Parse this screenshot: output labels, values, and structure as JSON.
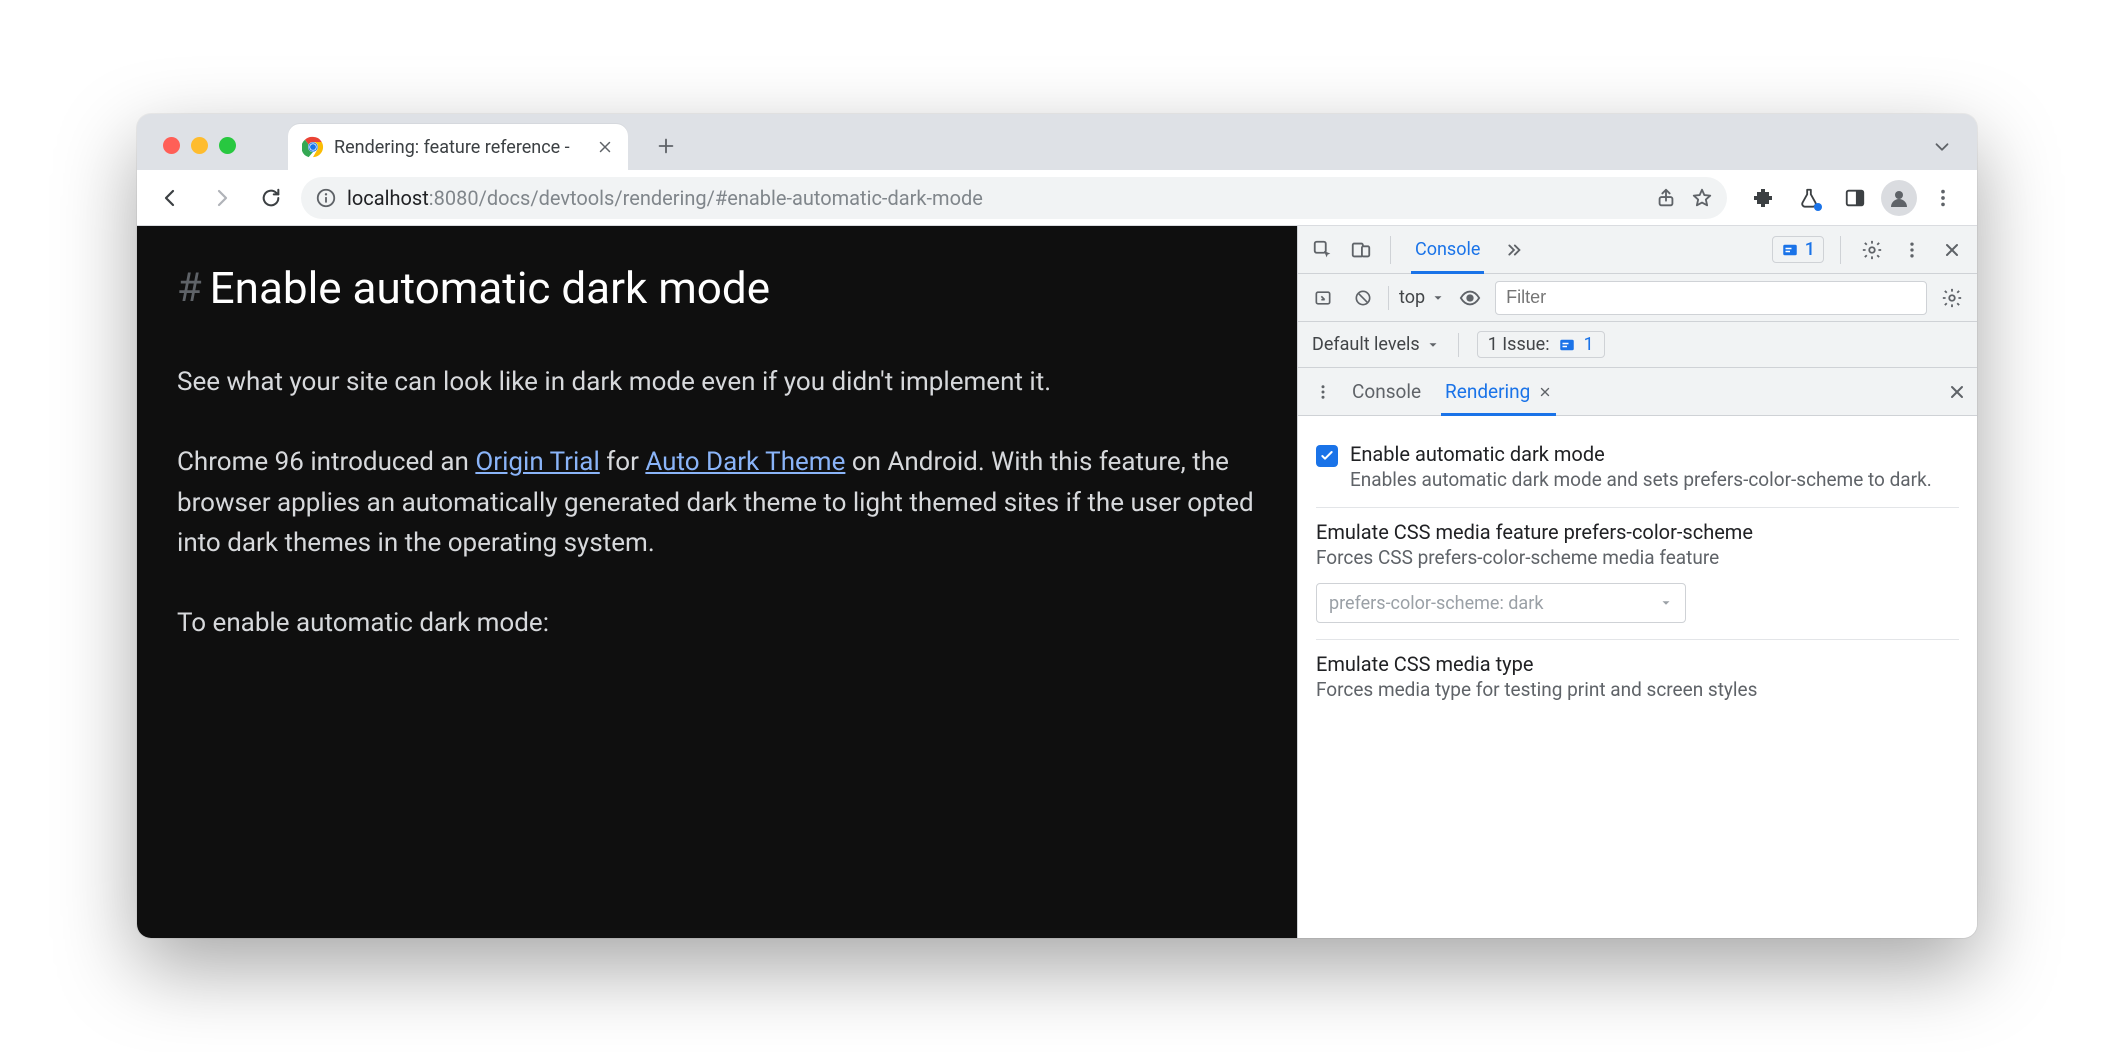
{
  "browser": {
    "tab_title": "Rendering: feature reference - ",
    "url_host": "localhost",
    "url_port": ":8080",
    "url_path": "/docs/devtools/rendering/#enable-automatic-dark-mode"
  },
  "page": {
    "heading": "Enable automatic dark mode",
    "intro": "See what your site can look like in dark mode even if you didn't implement it.",
    "para2_a": "Chrome 96 introduced an ",
    "para2_link1": "Origin Trial",
    "para2_b": " for ",
    "para2_link2": "Auto Dark Theme",
    "para2_c": " on Android. With this feature, the browser applies an automatically generated dark theme to light themed sites if the user opted into dark themes in the operating system.",
    "para3": "To enable automatic dark mode:"
  },
  "devtools": {
    "tabs": {
      "console": "Console"
    },
    "issue_count": "1",
    "console": {
      "context": "top",
      "filter_placeholder": "Filter",
      "levels": "Default levels",
      "issues_label": "1 Issue:",
      "issues_count": "1"
    },
    "drawer": {
      "tab_console": "Console",
      "tab_rendering": "Rendering"
    },
    "rendering": {
      "s1_title": "Enable automatic dark mode",
      "s1_desc": "Enables automatic dark mode and sets prefers-color-scheme to dark.",
      "s1_checked": true,
      "s2_title": "Emulate CSS media feature prefers-color-scheme",
      "s2_desc": "Forces CSS prefers-color-scheme media feature",
      "s2_select": "prefers-color-scheme: dark",
      "s3_title": "Emulate CSS media type",
      "s3_desc": "Forces media type for testing print and screen styles"
    }
  }
}
